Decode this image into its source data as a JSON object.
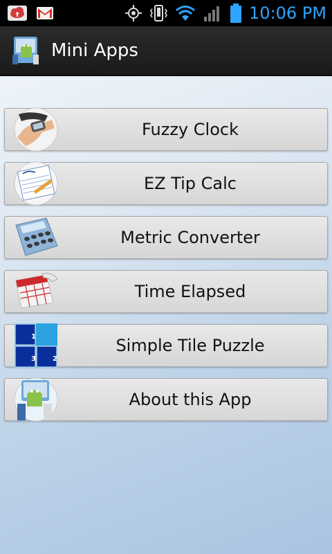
{
  "status_bar": {
    "time": "10:06 PM",
    "left_icons": [
      "cloud-notification-icon",
      "gmail-icon"
    ],
    "right_icons": [
      "gps-icon",
      "vibrate-icon",
      "wifi-icon",
      "signal-icon",
      "battery-icon"
    ]
  },
  "action_bar": {
    "title": "Mini Apps",
    "logo_icon": "android-app-logo-icon"
  },
  "menu": {
    "items": [
      {
        "label": "Fuzzy Clock",
        "icon": "wristwatch-icon"
      },
      {
        "label": "EZ Tip Calc",
        "icon": "guest-check-icon"
      },
      {
        "label": "Metric Converter",
        "icon": "calculator-icon"
      },
      {
        "label": "Time Elapsed",
        "icon": "calendar-icon"
      },
      {
        "label": "Simple Tile Puzzle",
        "icon": "tile-puzzle-icon",
        "tiles": [
          "1",
          "3",
          "2"
        ]
      },
      {
        "label": "About this App",
        "icon": "android-app-logo-icon"
      }
    ]
  },
  "colors": {
    "clock_text": "#2ea3ff",
    "action_bar": "#222222",
    "background_top": "#f4f8fb",
    "background_bottom": "#a9c4e2"
  }
}
